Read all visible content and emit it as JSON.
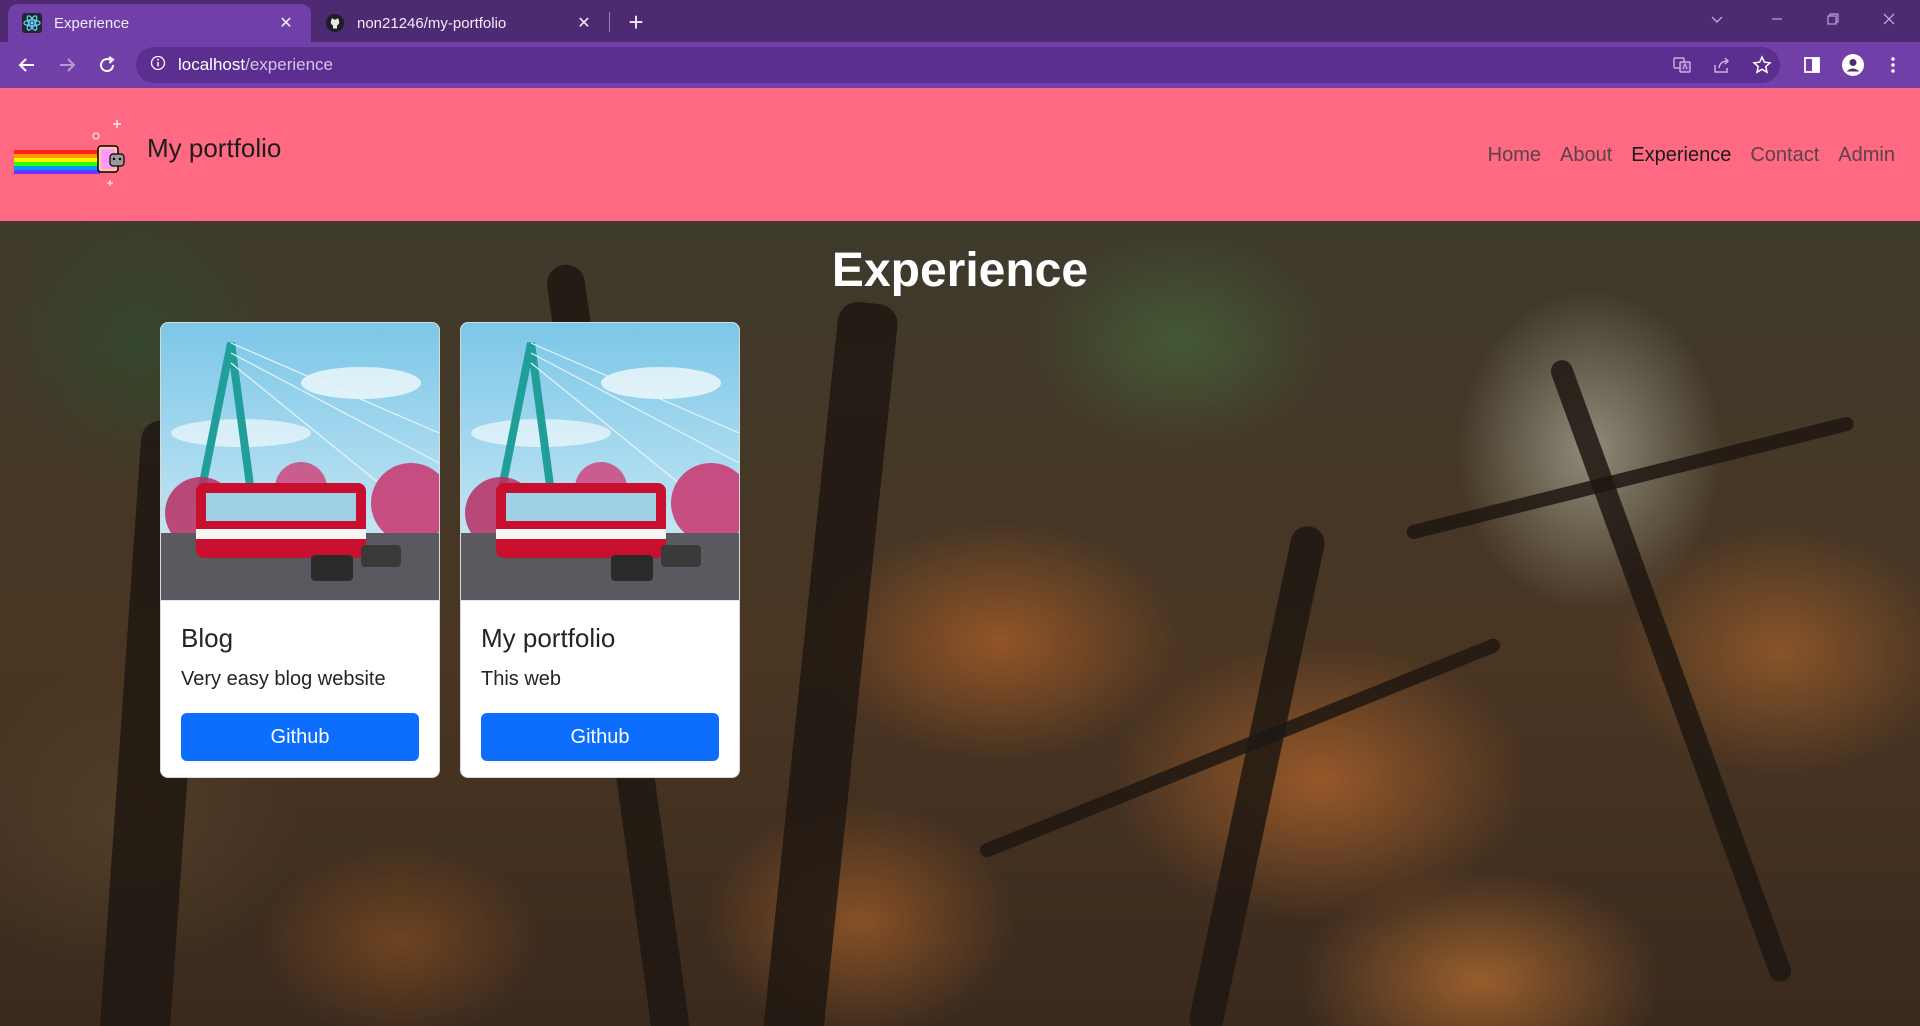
{
  "browser": {
    "tabs": [
      {
        "title": "Experience",
        "active": true,
        "icon": "react-icon"
      },
      {
        "title": "non21246/my-portfolio",
        "active": false,
        "icon": "github-icon"
      }
    ],
    "url": {
      "host": "localhost",
      "path": "/experience"
    }
  },
  "site": {
    "brand": "My portfolio",
    "nav": [
      {
        "label": "Home",
        "active": false
      },
      {
        "label": "About",
        "active": false
      },
      {
        "label": "Experience",
        "active": true
      },
      {
        "label": "Contact",
        "active": false
      },
      {
        "label": "Admin",
        "active": false
      }
    ],
    "colors": {
      "navbar": "#ff6a82",
      "button": "#0d6efd"
    }
  },
  "page": {
    "title": "Experience",
    "cards": [
      {
        "title": "Blog",
        "text": "Very easy blog website",
        "button": "Github"
      },
      {
        "title": "My portfolio",
        "text": "This web",
        "button": "Github"
      }
    ]
  }
}
